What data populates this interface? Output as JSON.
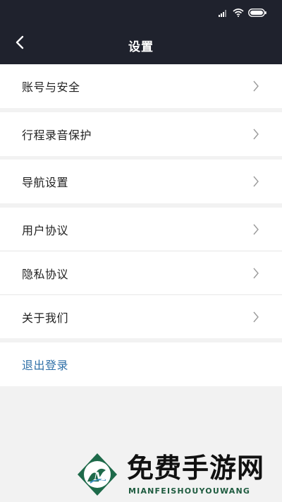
{
  "status_bar": {
    "signal_icon": "signal-icon",
    "wifi_icon": "wifi-icon",
    "battery_icon": "battery-icon"
  },
  "header": {
    "title": "设置",
    "back_icon": "chevron-left-icon"
  },
  "settings": {
    "groups": [
      {
        "items": [
          {
            "label": "账号与安全"
          }
        ]
      },
      {
        "items": [
          {
            "label": "行程录音保护"
          }
        ]
      },
      {
        "items": [
          {
            "label": "导航设置"
          }
        ]
      },
      {
        "items": [
          {
            "label": "用户协议"
          },
          {
            "label": "隐私协议"
          },
          {
            "label": "关于我们"
          }
        ]
      }
    ],
    "logout_label": "退出登录",
    "chevron_icon": "chevron-right-icon"
  },
  "watermark": {
    "text": "免费手游网",
    "subtext": "MIANFEISHOUYOUWANG"
  },
  "colors": {
    "header_bg": "#1f222d",
    "page_bg": "#f2f2f2",
    "logout_text": "#2f70a8"
  }
}
